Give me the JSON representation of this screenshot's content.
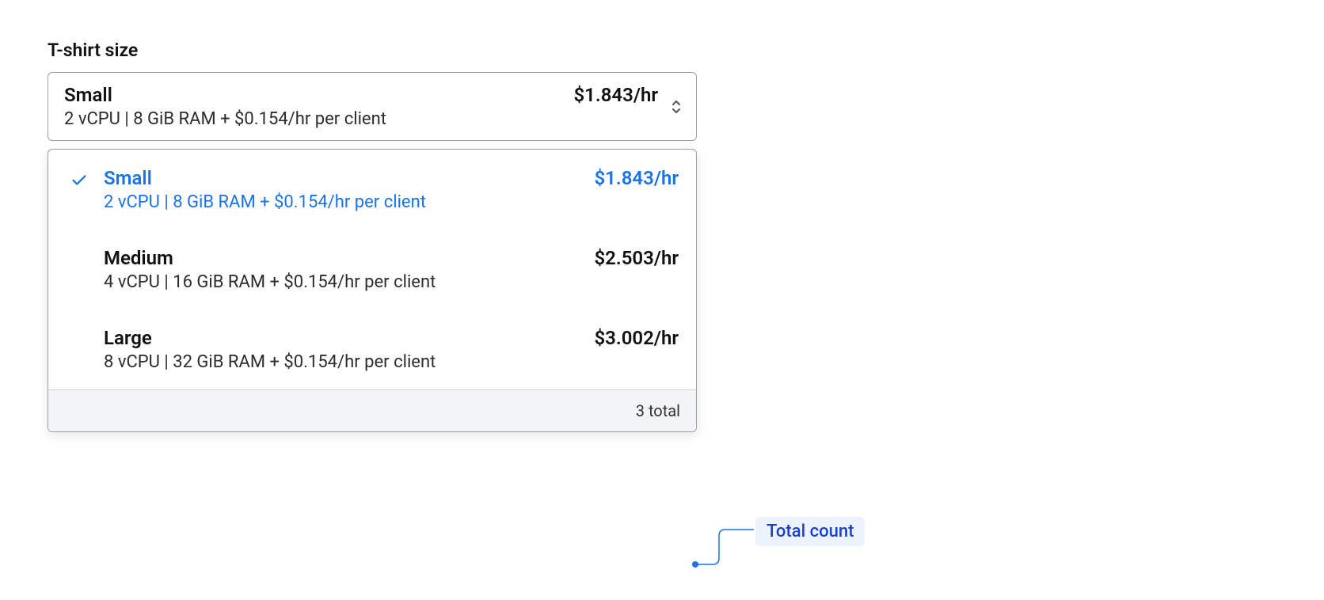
{
  "label": "T-shirt size",
  "selected": {
    "name": "Small",
    "price": "$1.843/hr",
    "desc": "2 vCPU | 8 GiB RAM + $0.154/hr per client"
  },
  "options": [
    {
      "name": "Small",
      "price": "$1.843/hr",
      "desc": "2 vCPU | 8 GiB RAM + $0.154/hr per client",
      "selected": true
    },
    {
      "name": "Medium",
      "price": "$2.503/hr",
      "desc": "4 vCPU | 16 GiB RAM + $0.154/hr per client",
      "selected": false
    },
    {
      "name": "Large",
      "price": "$3.002/hr",
      "desc": "8 vCPU | 32 GiB RAM + $0.154/hr per client",
      "selected": false
    }
  ],
  "footer": {
    "total_text": "3 total"
  },
  "annotation": {
    "label": "Total count"
  }
}
